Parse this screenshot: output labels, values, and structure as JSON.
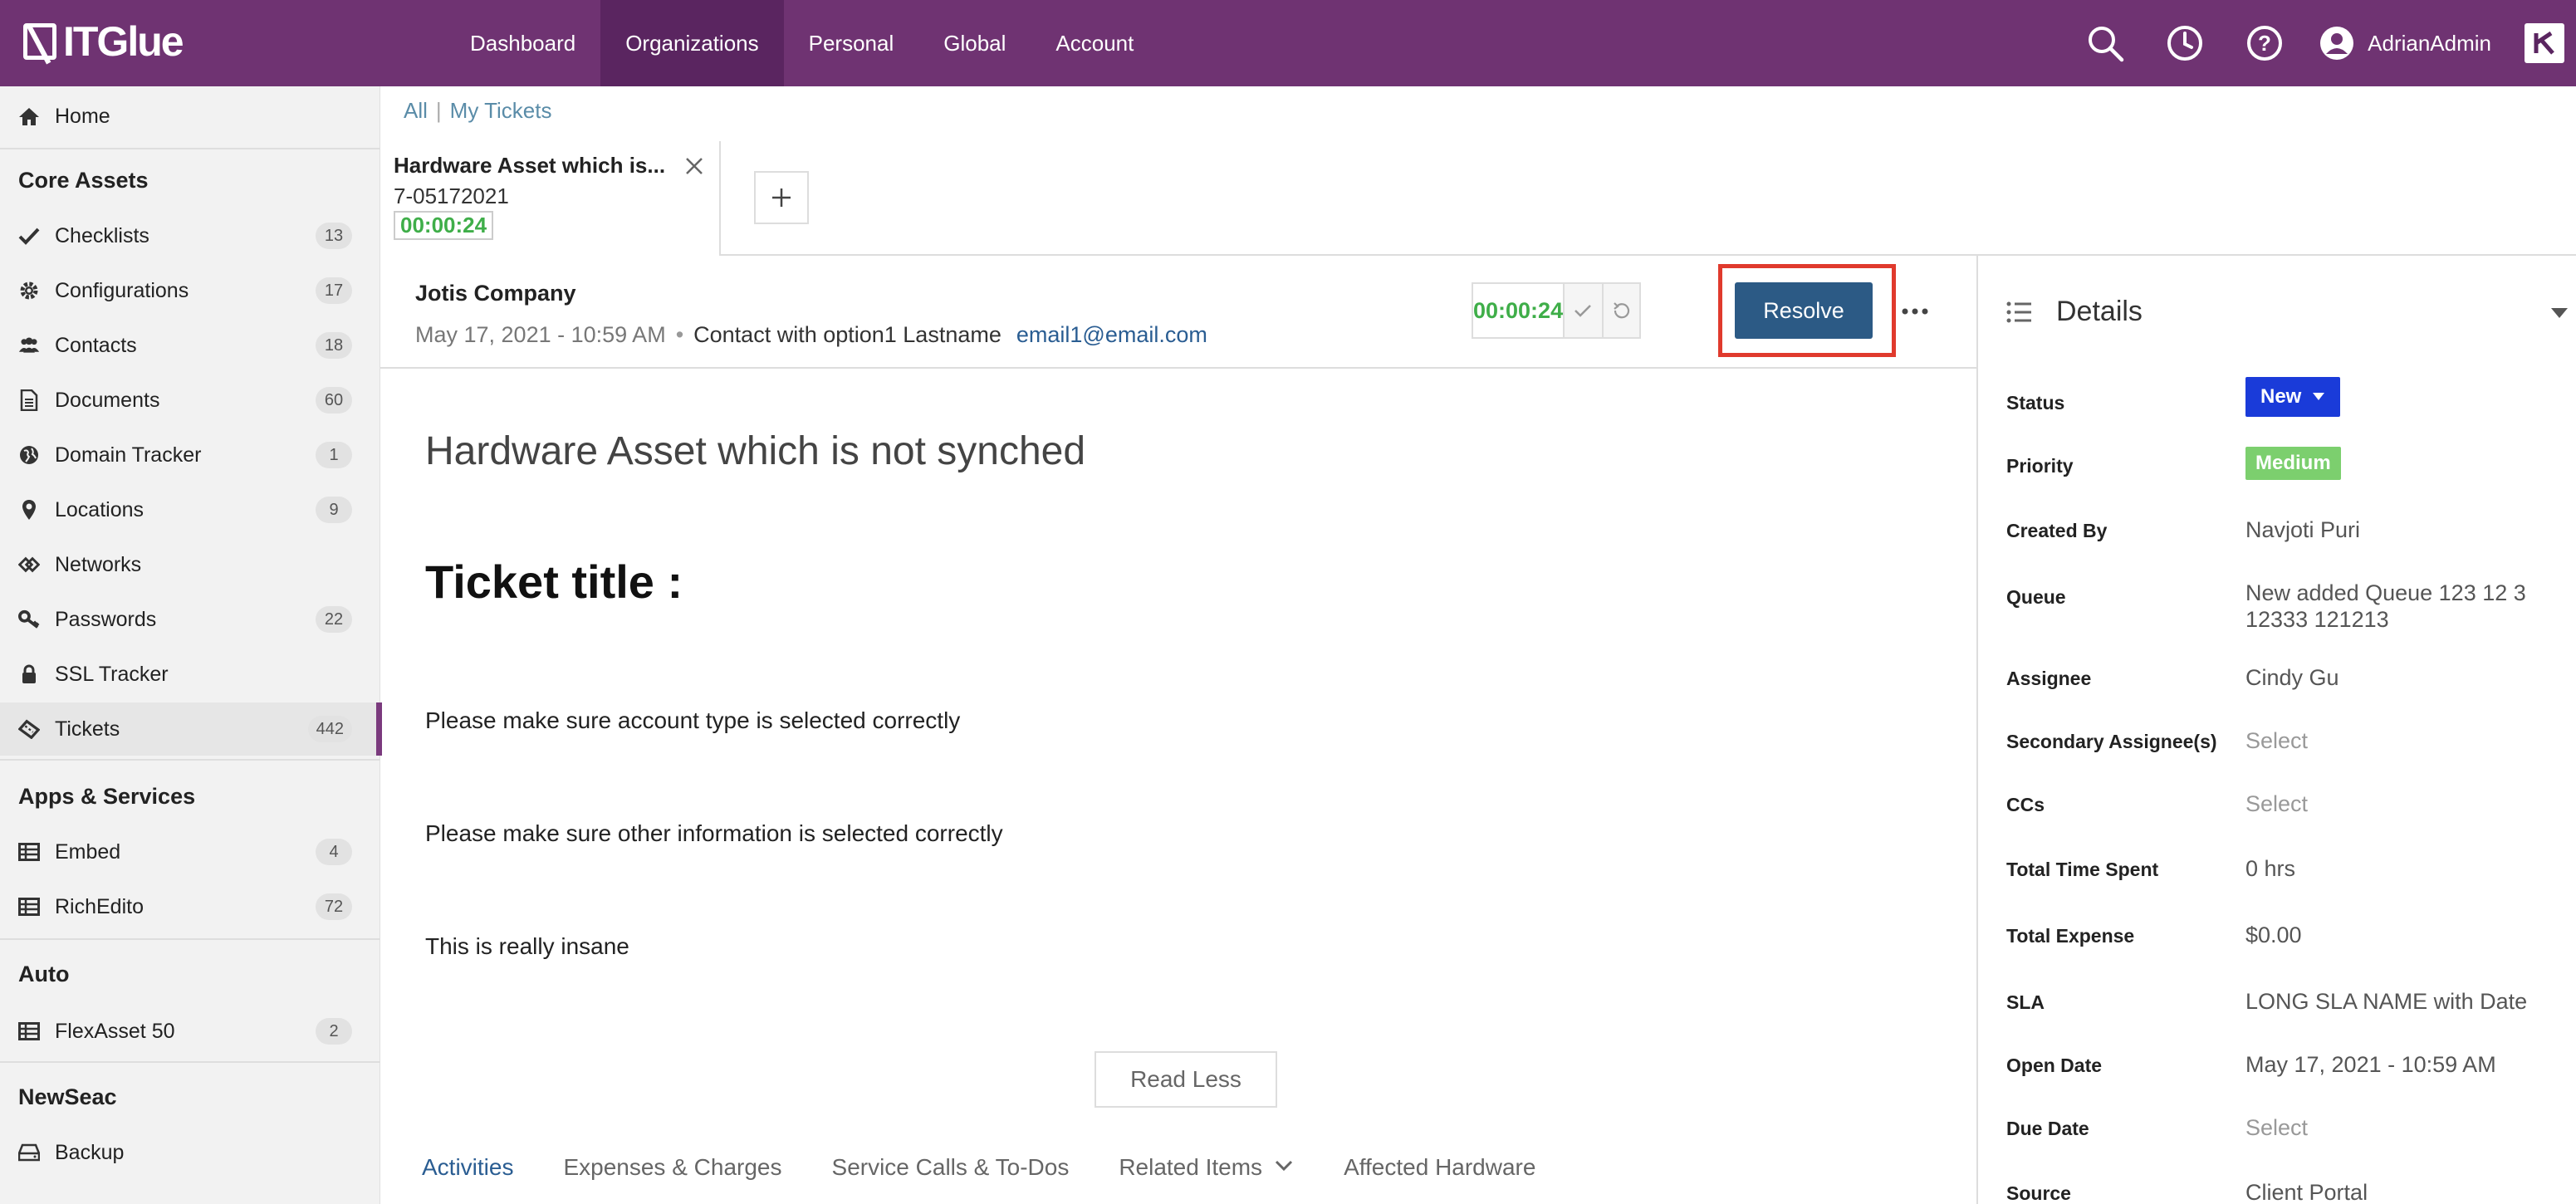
{
  "app": {
    "logo": "ITGlue"
  },
  "nav": {
    "items": [
      "Dashboard",
      "Organizations",
      "Personal",
      "Global",
      "Account"
    ],
    "active": "Organizations"
  },
  "user": {
    "name": "AdrianAdmin"
  },
  "sidebar": {
    "home": "Home",
    "sections": {
      "core_assets": "Core Assets",
      "apps_services": "Apps & Services",
      "auto": "Auto",
      "newseac": "NewSeac"
    },
    "core_items": [
      {
        "label": "Checklists",
        "count": "13",
        "icon": "check-icon"
      },
      {
        "label": "Configurations",
        "count": "17",
        "icon": "gear-icon"
      },
      {
        "label": "Contacts",
        "count": "18",
        "icon": "users-icon"
      },
      {
        "label": "Documents",
        "count": "60",
        "icon": "document-icon"
      },
      {
        "label": "Domain Tracker",
        "count": "1",
        "icon": "globe-icon"
      },
      {
        "label": "Locations",
        "count": "9",
        "icon": "map-pin-icon"
      },
      {
        "label": "Networks",
        "count": "",
        "icon": "network-icon"
      },
      {
        "label": "Passwords",
        "count": "22",
        "icon": "key-icon"
      },
      {
        "label": "SSL Tracker",
        "count": "",
        "icon": "lock-icon"
      },
      {
        "label": "Tickets",
        "count": "442",
        "icon": "ticket-icon"
      }
    ],
    "apps_items": [
      {
        "label": "Embed",
        "count": "4",
        "icon": "table-icon"
      },
      {
        "label": "RichEdito",
        "count": "72",
        "icon": "table-icon"
      }
    ],
    "auto_items": [
      {
        "label": "FlexAsset 50",
        "count": "2",
        "icon": "table-icon"
      }
    ],
    "newseac_items": [
      {
        "label": "Backup",
        "count": "",
        "icon": "drive-icon"
      }
    ],
    "active_item": "Tickets"
  },
  "breadcrumb": {
    "all": "All",
    "separator": "|",
    "mine": "My Tickets"
  },
  "ticket_tab": {
    "title": "Hardware Asset which is...",
    "number": "7-05172021",
    "timer": "00:00:24"
  },
  "ticket": {
    "company": "Jotis Company",
    "date": "May 17, 2021 - 10:59 AM",
    "separator": "•",
    "contact": "Contact with option1 Lastname",
    "email": "email1@email.com",
    "timer": "00:00:24",
    "resolve_label": "Resolve",
    "title": "Hardware Asset which is not synched",
    "heading": "Ticket title :",
    "paragraphs": [
      "Please make sure account type is selected correctly",
      "Please make sure other information is selected correctly",
      "This is really insane"
    ],
    "read_less": "Read Less"
  },
  "bottom_tabs": [
    "Activities",
    "Expenses & Charges",
    "Service Calls & To-Dos",
    "Related Items",
    "Affected Hardware"
  ],
  "details": {
    "title": "Details",
    "labels": {
      "status": "Status",
      "priority": "Priority",
      "created_by": "Created By",
      "queue": "Queue",
      "assignee": "Assignee",
      "secondary": "Secondary Assignee(s)",
      "ccs": "CCs",
      "time_spent": "Total Time Spent",
      "expense": "Total Expense",
      "sla": "SLA",
      "open_date": "Open Date",
      "due_date": "Due Date",
      "source": "Source"
    },
    "values": {
      "status": "New",
      "priority": "Medium",
      "created_by": "Navjoti Puri",
      "queue": "New added Queue 123 12 3 12333 121213",
      "assignee": "Cindy Gu",
      "secondary": "Select",
      "ccs": "Select",
      "time_spent": "0 hrs",
      "expense": "$0.00",
      "sla": "LONG SLA NAME with Date",
      "open_date": "May 17, 2021 - 10:59 AM",
      "due_date": "Select",
      "source": "Client Portal"
    }
  },
  "colors": {
    "brand": "#6f3372",
    "resolve": "#2c5a85",
    "status_new": "#1a3bd9",
    "priority_medium": "#7ccf6e",
    "timer_green": "#3fae49",
    "highlight": "#e03a2d"
  }
}
